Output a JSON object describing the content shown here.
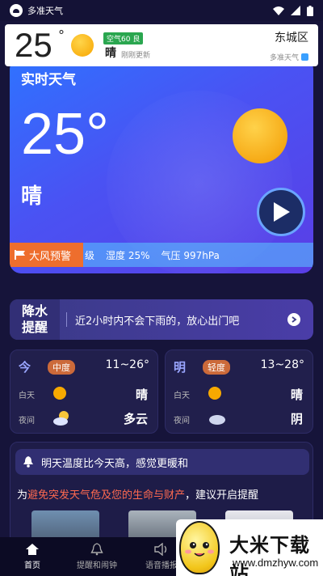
{
  "status_bar": {
    "app_name": "多准天气"
  },
  "widget": {
    "temp": "25",
    "degree": "°",
    "aqi": "空气60 良",
    "condition": "晴",
    "updated": "刚刚更新",
    "district": "东城区",
    "brand": "多准天气"
  },
  "realtime": {
    "title": "实时天气",
    "temp": "25°",
    "condition": "晴",
    "alert": "大风预警",
    "wind_fragment": "级",
    "humidity": "湿度 25%",
    "pressure": "气压 997hPa"
  },
  "rain": {
    "label_line1": "降水",
    "label_line2": "提醒",
    "message": "近2小时内不会下雨的，放心出门吧"
  },
  "today": {
    "name": "今",
    "air": "中度",
    "range": "11~26°",
    "day_label": "白天",
    "day_cond": "晴",
    "night_label": "夜间",
    "night_cond": "多云"
  },
  "tomorrow": {
    "name": "明",
    "air": "轻度",
    "range": "13~28°",
    "day_label": "白天",
    "day_cond": "晴",
    "night_label": "夜间",
    "night_cond": "阴"
  },
  "tip": {
    "text": "明天温度比今天高，感觉更暖和"
  },
  "warning": {
    "prefix": "为",
    "highlight": "避免突发天气危及您的生命与财产",
    "suffix": "，建议开启提醒"
  },
  "tabs": [
    {
      "label": "首页"
    },
    {
      "label": "提醒和闹钟"
    },
    {
      "label": "语音播报"
    }
  ],
  "watermark": {
    "name": "大米下载站",
    "url": "www.dmzhyw.com"
  },
  "colors": {
    "accent_orange": "#ee6e2d",
    "aqi_green": "#2aa64f",
    "card_blue": "#2f72ff"
  }
}
